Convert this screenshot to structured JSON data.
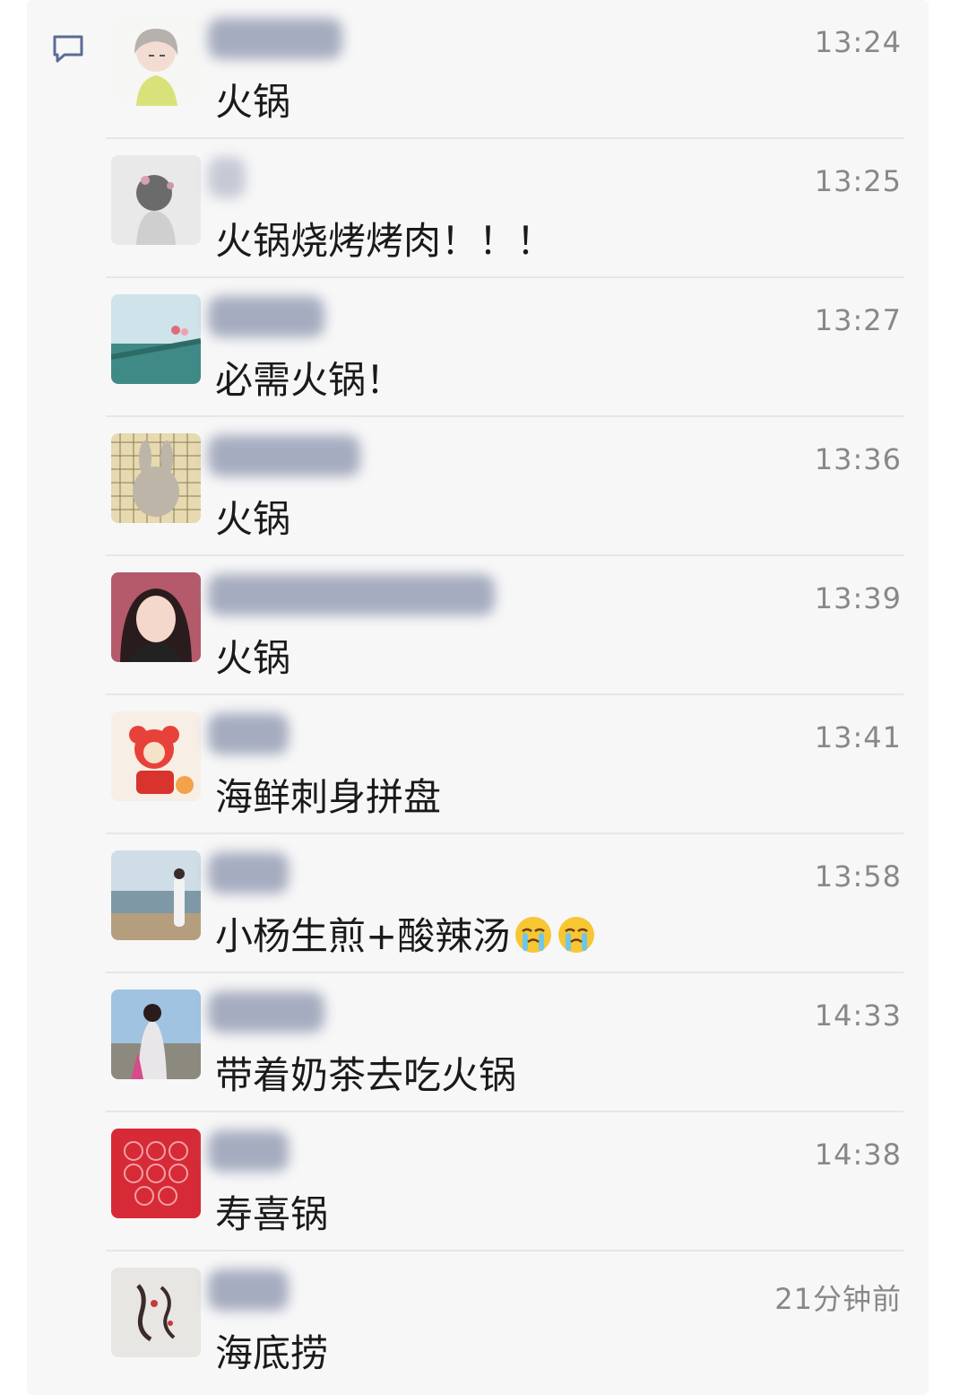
{
  "comments": [
    {
      "time": "13:24",
      "text": "火锅",
      "avatar": "cartoon-girl-yellow"
    },
    {
      "time": "13:25",
      "text": "火锅烧烤烤肉！！！",
      "avatar": "sketch-girl-flower"
    },
    {
      "time": "13:27",
      "text": "必需火锅！",
      "avatar": "seaside-bridge"
    },
    {
      "time": "13:36",
      "text": "火锅",
      "avatar": "go-board-rabbit"
    },
    {
      "time": "13:39",
      "text": "火锅",
      "avatar": "woman-portrait"
    },
    {
      "time": "13:41",
      "text": "海鲜刺身拼盘",
      "avatar": "red-mouse-doll"
    },
    {
      "time": "13:58",
      "text": "小杨生煎+酸辣汤",
      "avatar": "beach-woman",
      "emoji_count": 2,
      "emoji": "crying-face"
    },
    {
      "time": "14:33",
      "text": "带着奶茶去吃火锅",
      "avatar": "girl-sky"
    },
    {
      "time": "14:38",
      "text": "寿喜锅",
      "avatar": "red-pattern"
    },
    {
      "time": "21分钟前",
      "text": "海底捞",
      "avatar": "calligraphy-art"
    }
  ],
  "colors": {
    "background": "#f7f7f7",
    "time": "#888888",
    "text": "#1a1a1a",
    "icon": "#5b6b96"
  }
}
